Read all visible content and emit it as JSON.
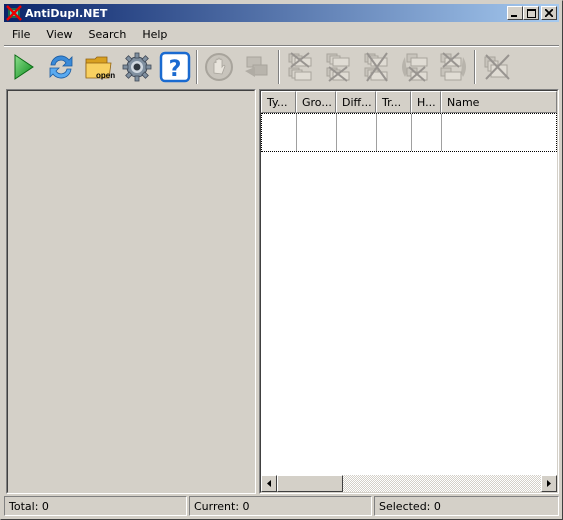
{
  "window": {
    "title": "AntiDupl.NET",
    "controls": {
      "minimize": "_",
      "maximize": "□",
      "close": "✕"
    }
  },
  "menu": [
    {
      "label": "File"
    },
    {
      "label": "View"
    },
    {
      "label": "Search"
    },
    {
      "label": "Help"
    }
  ],
  "toolbar": {
    "groups": [
      [
        {
          "name": "start-search",
          "icon": "play-icon",
          "enabled": true
        },
        {
          "name": "refresh",
          "icon": "refresh-icon",
          "enabled": true
        },
        {
          "name": "open",
          "icon": "folder-open-icon",
          "label": "open",
          "enabled": true
        },
        {
          "name": "options",
          "icon": "gear-icon",
          "enabled": true
        },
        {
          "name": "help",
          "icon": "help-icon",
          "label": "?",
          "enabled": true
        }
      ],
      [
        {
          "name": "stop",
          "icon": "stop-hand-icon",
          "enabled": false
        },
        {
          "name": "mistake",
          "icon": "mistake-icon",
          "enabled": false
        }
      ],
      [
        {
          "name": "delete-first",
          "icon": "delete-first-icon",
          "enabled": false
        },
        {
          "name": "delete-second",
          "icon": "delete-second-icon",
          "enabled": false
        },
        {
          "name": "delete-both",
          "icon": "delete-both-icon",
          "enabled": false
        },
        {
          "name": "replace-first-by-second",
          "icon": "replace-first-icon",
          "enabled": false
        },
        {
          "name": "replace-second-by-first",
          "icon": "replace-second-icon",
          "enabled": false
        }
      ],
      [
        {
          "name": "delete-defect",
          "icon": "delete-defect-icon",
          "enabled": false
        }
      ]
    ]
  },
  "results": {
    "columns": [
      {
        "label": "Ty..."
      },
      {
        "label": "Gro..."
      },
      {
        "label": "Diff..."
      },
      {
        "label": "Tr..."
      },
      {
        "label": "H..."
      },
      {
        "label": "Name"
      }
    ],
    "rows": []
  },
  "status": {
    "total": "Total: 0",
    "current": "Current: 0",
    "selected": "Selected: 0"
  }
}
